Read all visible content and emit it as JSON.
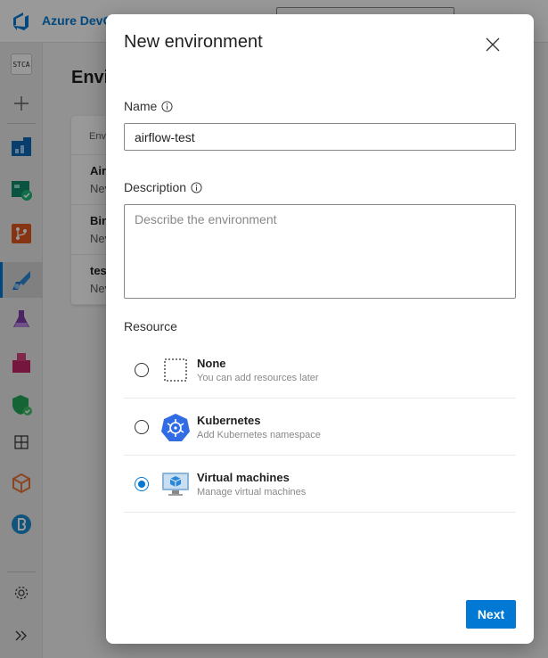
{
  "app": {
    "title": "Azure DevOps",
    "project_badge": "STCA"
  },
  "page": {
    "heading": "Environments",
    "table_header": "Environment",
    "rows": [
      {
        "name": "Airflow",
        "sub": "Never deployed"
      },
      {
        "name": "Bingo",
        "sub": "Never deployed"
      },
      {
        "name": "test",
        "sub": "Never deployed"
      }
    ]
  },
  "sidebar": {
    "items": [
      {
        "icon": "plus-icon"
      },
      {
        "icon": "boards-icon"
      },
      {
        "icon": "test-plans-icon"
      },
      {
        "icon": "repos-icon"
      },
      {
        "icon": "pipelines-icon",
        "active": true
      },
      {
        "icon": "flask-icon"
      },
      {
        "icon": "artifacts-icon"
      },
      {
        "icon": "security-icon"
      },
      {
        "icon": "grid-icon"
      },
      {
        "icon": "package-icon"
      },
      {
        "icon": "b-icon"
      },
      {
        "icon": "gear-icon"
      },
      {
        "icon": "expand-icon"
      }
    ]
  },
  "dialog": {
    "title": "New environment",
    "name_label": "Name",
    "name_value": "airflow-test",
    "description_label": "Description",
    "description_placeholder": "Describe the environment",
    "resource_label": "Resource",
    "options": [
      {
        "title": "None",
        "subtitle": "You can add resources later",
        "icon": "dotted-box-icon",
        "selected": false
      },
      {
        "title": "Kubernetes",
        "subtitle": "Add Kubernetes namespace",
        "icon": "kubernetes-icon",
        "selected": false
      },
      {
        "title": "Virtual machines",
        "subtitle": "Manage virtual machines",
        "icon": "virtual-machine-icon",
        "selected": true
      }
    ],
    "next_label": "Next"
  },
  "colors": {
    "accent": "#0078d4",
    "scrim": "rgba(0,0,0,0.40)"
  }
}
